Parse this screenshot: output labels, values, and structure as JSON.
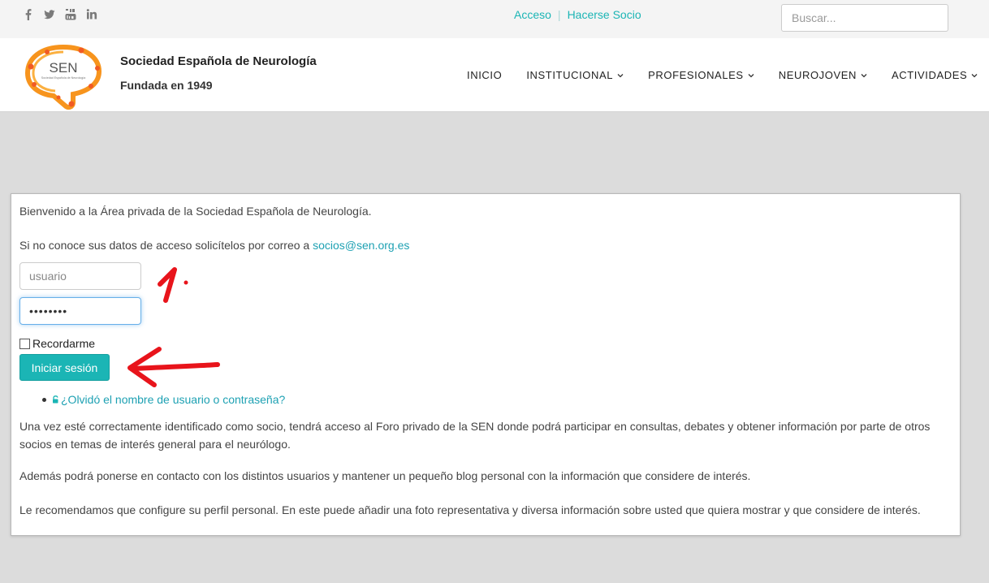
{
  "topbar": {
    "social_icons": [
      "facebook-icon",
      "twitter-icon",
      "youtube-icon",
      "linkedin-icon"
    ],
    "links": {
      "login": "Acceso",
      "join": "Hacerse Socio"
    },
    "search_placeholder": "Buscar..."
  },
  "header": {
    "logo_text": "SEN",
    "logo_subtext": "Sociedad Española de Neurología",
    "title": "Sociedad Española de Neurología",
    "subtitle": "Fundada en 1949",
    "nav": [
      {
        "label": "INICIO",
        "dropdown": false
      },
      {
        "label": "INSTITUCIONAL",
        "dropdown": true
      },
      {
        "label": "PROFESIONALES",
        "dropdown": true
      },
      {
        "label": "NEUROJOVEN",
        "dropdown": true
      },
      {
        "label": "ACTIVIDADES",
        "dropdown": true
      }
    ]
  },
  "login": {
    "welcome": "Bienvenido a la Área privada de la Sociedad Española de Neurología.",
    "contact_prefix": "Si no conoce sus datos de acceso solicítelos por correo a ",
    "contact_email": "socios@sen.org.es",
    "username_placeholder": "usuario",
    "password_value": "••••••••",
    "remember_label": "Recordarme",
    "remember_checked": false,
    "submit_label": "Iniciar sesión",
    "forgot_label": "¿Olvidó el nombre de usuario o contraseña?",
    "info_1": "Una vez esté correctamente identificado como socio, tendrá acceso al Foro privado de la SEN donde podrá participar en consultas, debates y obtener información por parte de otros socios en temas de interés general para el neurólogo.",
    "info_2": "Además podrá ponerse en contacto con los distintos usuarios y mantener un pequeño blog personal con la información que considere de interés.",
    "info_3": "Le recomendamos que configure su perfil personal. En este puede añadir una foto representativa y diversa información sobre usted que quiera mostrar y que considere de interés."
  },
  "colors": {
    "accent": "#1bb5b5",
    "link": "#1ea1b3",
    "logo_orange": "#f7941d",
    "annotation_red": "#e8141b"
  }
}
